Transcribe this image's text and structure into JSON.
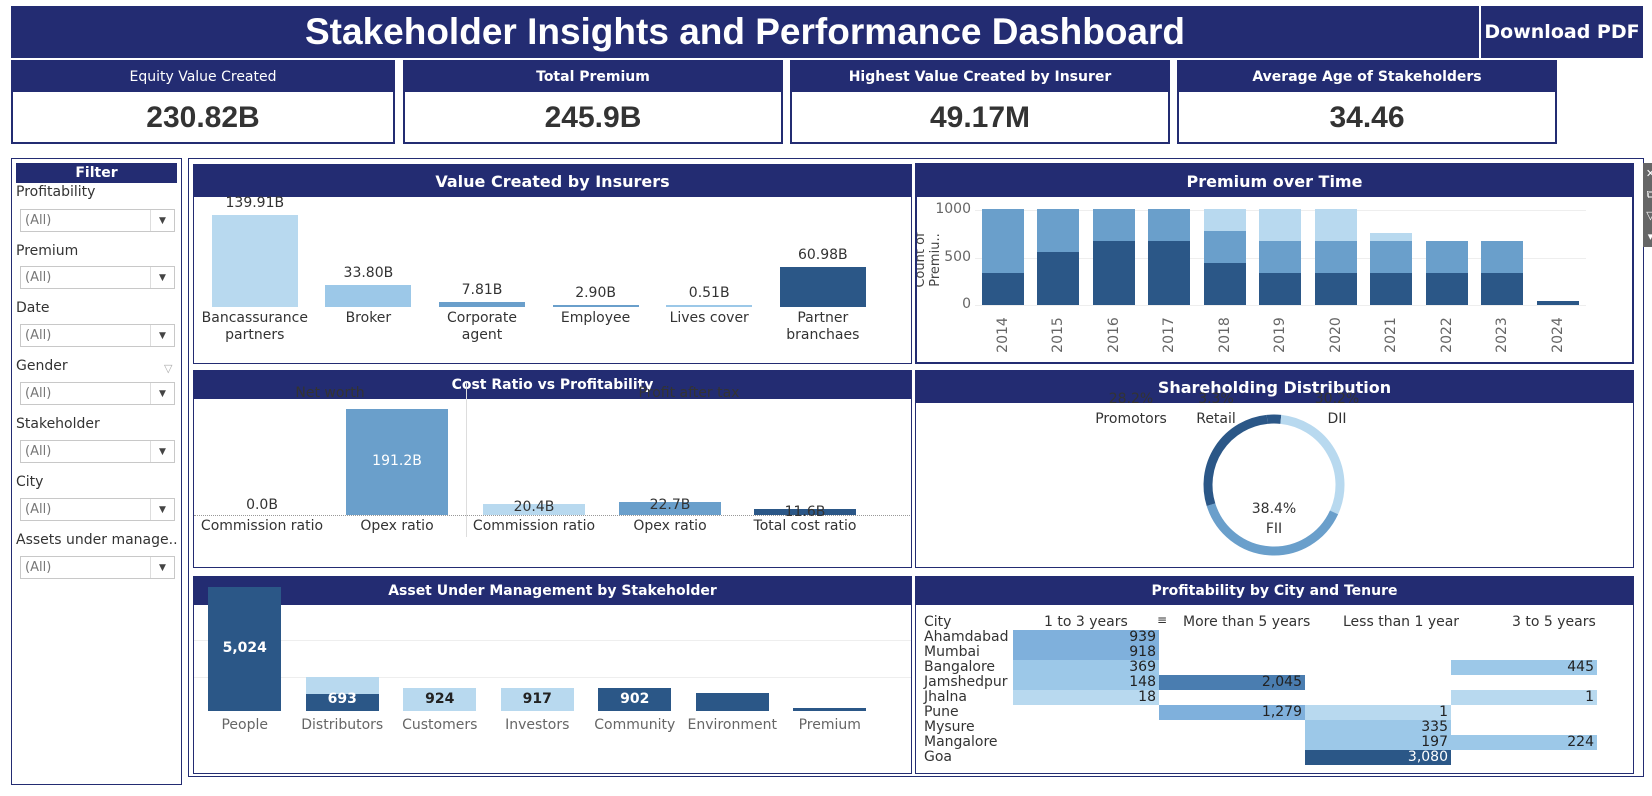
{
  "header": {
    "title": "Stakeholder Insights and Performance Dashboard",
    "download_label": "Download PDF"
  },
  "kpis": [
    {
      "label": "Equity Value Created",
      "value": "230.82B"
    },
    {
      "label": "Total Premium",
      "value": "245.9B"
    },
    {
      "label": "Highest Value Created by Insurer",
      "value": "49.17M"
    },
    {
      "label": "Average Age of Stakeholders",
      "value": "34.46"
    }
  ],
  "filter": {
    "title": "Filter",
    "items": [
      {
        "label": "Profitability",
        "value": "(All)"
      },
      {
        "label": "Premium",
        "value": "(All)"
      },
      {
        "label": "Date",
        "value": "(All)"
      },
      {
        "label": "Gender",
        "value": "(All)"
      },
      {
        "label": "Stakeholder",
        "value": "(All)"
      },
      {
        "label": "City",
        "value": "(All)"
      },
      {
        "label": "Assets under manage..",
        "value": "(All)"
      }
    ]
  },
  "colors": {
    "navy": "#232c72",
    "light": "#b8d9ef",
    "mid": "#6a9fcb",
    "dark": "#2b5787",
    "lighter": "#9cc8e8"
  },
  "panels": {
    "value_created": {
      "title": "Value Created by Insurers"
    },
    "premium_time": {
      "title": "Premium over  Time",
      "ylabel": "Count of Premiu.."
    },
    "cost_ratio": {
      "title": "Cost Ratio vs Profitability",
      "left_title": "Net worth",
      "right_title": "Profit after tax"
    },
    "shareholding": {
      "title": "Shareholding Distribution"
    },
    "aum": {
      "title": "Asset Under Management by Stakeholder"
    },
    "profitability": {
      "title": "Profitability by City and Tenure",
      "columns": [
        "City",
        "1 to 3 years",
        "More than 5 years",
        "Less than 1 year",
        "3 to 5 years"
      ],
      "rows": [
        {
          "city": "Ahamdabad",
          "values": [
            "939",
            "",
            "",
            ""
          ]
        },
        {
          "city": "Mumbai",
          "values": [
            "918",
            "",
            "",
            ""
          ]
        },
        {
          "city": "Bangalore",
          "values": [
            "369",
            "",
            "",
            "445"
          ]
        },
        {
          "city": "Jamshedpur",
          "values": [
            "148",
            "2,045",
            "",
            ""
          ]
        },
        {
          "city": "Jhalna",
          "values": [
            "18",
            "",
            "",
            "1"
          ]
        },
        {
          "city": "Pune",
          "values": [
            "",
            "1,279",
            "1",
            ""
          ]
        },
        {
          "city": "Mysure",
          "values": [
            "",
            "",
            "335",
            ""
          ]
        },
        {
          "city": "Mangalore",
          "values": [
            "",
            "",
            "197",
            "224"
          ]
        },
        {
          "city": "Goa",
          "values": [
            "",
            "",
            "3,080",
            ""
          ]
        }
      ]
    }
  },
  "chart_data": [
    {
      "type": "bar",
      "title": "Value Created by Insurers",
      "categories": [
        "Bancassurance partners",
        "Broker",
        "Corporate agent",
        "Employee",
        "Lives cover",
        "Partner branchaes"
      ],
      "values": [
        139.91,
        33.8,
        7.81,
        2.9,
        0.51,
        60.98
      ],
      "labels": [
        "139.91B",
        "33.80B",
        "7.81B",
        "2.90B",
        "0.51B",
        "60.98B"
      ],
      "unit": "B"
    },
    {
      "type": "bar",
      "title": "Premium over  Time",
      "ylabel": "Count of Premiu..",
      "categories": [
        "2014",
        "2015",
        "2016",
        "2017",
        "2018",
        "2019",
        "2020",
        "2021",
        "2022",
        "2023",
        "2024"
      ],
      "yticks": [
        0,
        500,
        1000
      ],
      "ylim": [
        0,
        1100
      ],
      "series": [
        {
          "color": "dark",
          "values": [
            340,
            560,
            680,
            680,
            440,
            340,
            340,
            340,
            340,
            340,
            40
          ]
        },
        {
          "color": "mid",
          "values": [
            680,
            460,
            340,
            340,
            340,
            340,
            340,
            340,
            340,
            340,
            0
          ]
        },
        {
          "color": "light",
          "values": [
            0,
            0,
            0,
            0,
            240,
            340,
            340,
            80,
            0,
            0,
            0
          ]
        }
      ]
    },
    {
      "type": "bar",
      "title": "Cost Ratio vs Profitability",
      "groups": [
        {
          "name": "Net worth",
          "categories": [
            "Commission ratio",
            "Opex ratio"
          ],
          "values": [
            0.0,
            191.2
          ],
          "labels": [
            "0.0B",
            "191.2B"
          ]
        },
        {
          "name": "Profit after tax",
          "categories": [
            "Commission ratio",
            "Opex ratio",
            "Total cost ratio"
          ],
          "values": [
            20.4,
            22.7,
            11.6
          ],
          "labels": [
            "20.4B",
            "22.7B",
            "11.6B"
          ]
        }
      ]
    },
    {
      "type": "pie",
      "title": "Shareholding Distribution",
      "categories": [
        "Promotors",
        "Retail",
        "DII",
        "FII"
      ],
      "values": [
        28.2,
        3.3,
        30.2,
        38.4
      ],
      "labels": [
        "28.2%",
        "3.3%",
        "30.2%",
        "38.4%"
      ]
    },
    {
      "type": "bar",
      "title": "Asset Under Management by Stakeholder",
      "categories": [
        "People",
        "Distributors",
        "Customers",
        "Investors",
        "Community",
        "Environment",
        "Premium"
      ],
      "values": [
        5024,
        693,
        924,
        917,
        902,
        0,
        0
      ],
      "labels": [
        "5,024",
        "693",
        "924",
        "917",
        "902",
        "",
        ""
      ]
    }
  ]
}
